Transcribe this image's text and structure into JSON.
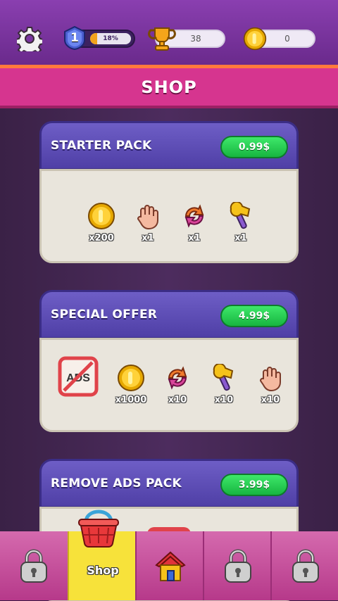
{
  "header": {
    "level": "1",
    "level_progress_percent": 18,
    "level_progress_label": "18%",
    "trophies": "38",
    "coins": "0"
  },
  "title": "SHOP",
  "packs": [
    {
      "name": "STARTER PACK",
      "price": "0.99$",
      "items": [
        {
          "icon": "coin-icon",
          "qty": "x200"
        },
        {
          "icon": "hand-icon",
          "qty": "x1"
        },
        {
          "icon": "swap-icon",
          "qty": "x1"
        },
        {
          "icon": "hammer-icon",
          "qty": "x1"
        }
      ]
    },
    {
      "name": "SPECIAL OFFER",
      "price": "4.99$",
      "items": [
        {
          "icon": "no-ads-icon",
          "qty": ""
        },
        {
          "icon": "coin-icon",
          "qty": "x1000"
        },
        {
          "icon": "swap-icon",
          "qty": "x10"
        },
        {
          "icon": "hammer-icon",
          "qty": "x10"
        },
        {
          "icon": "hand-icon",
          "qty": "x10"
        }
      ]
    },
    {
      "name": "REMOVE ADS PACK",
      "price": "3.99$"
    }
  ],
  "nav": {
    "tabs": [
      {
        "icon": "lock-icon",
        "label": ""
      },
      {
        "icon": "basket-icon",
        "label": "Shop",
        "active": true
      },
      {
        "icon": "house-icon",
        "label": ""
      },
      {
        "icon": "lock-icon",
        "label": ""
      },
      {
        "icon": "lock-icon",
        "label": ""
      }
    ]
  },
  "colors": {
    "header_purple": "#7a35a0",
    "title_pink": "#d6358f",
    "price_green": "#22c54a",
    "card_head": "#5c4cb6",
    "card_body": "#e9e5dc",
    "nav_active": "#f7e23a"
  }
}
